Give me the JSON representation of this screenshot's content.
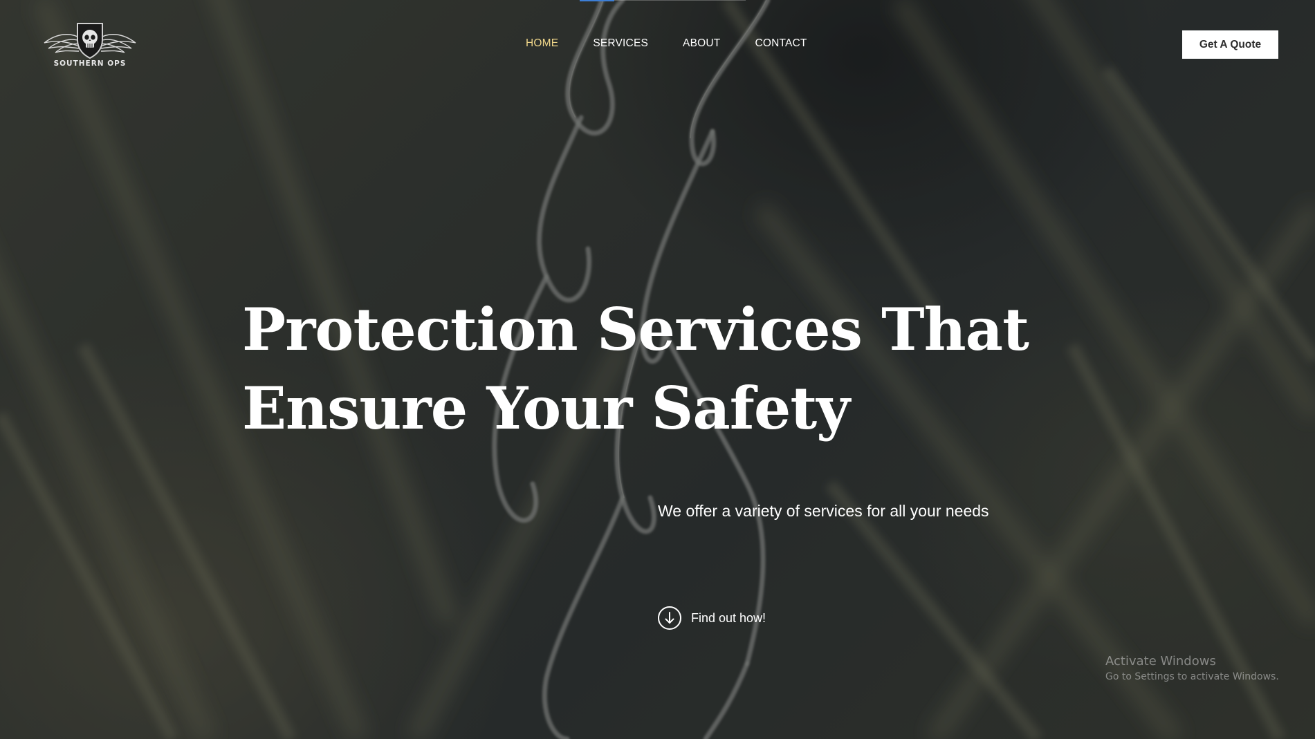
{
  "brand": {
    "logo_text": "SOUTHERN OPS",
    "logo_icon": "winged-skull-shield-logo"
  },
  "nav": {
    "items": [
      {
        "label": "HOME",
        "active": true
      },
      {
        "label": "SERVICES",
        "active": false
      },
      {
        "label": "ABOUT",
        "active": false
      },
      {
        "label": "CONTACT",
        "active": false
      }
    ],
    "active_color": "#f0d78a"
  },
  "header": {
    "quote_button_label": "Get A Quote"
  },
  "hero": {
    "headline_line1": "Protection Services That",
    "headline_line2": "Ensure Your Safety",
    "subtext": "We offer a variety of services for all your needs",
    "cta_label": "Find out how!",
    "cta_icon": "arrow-down-circle-icon",
    "background": "blurred chain-link fence"
  },
  "windows_watermark": {
    "title": "Activate Windows",
    "subtitle": "Go to Settings to activate Windows."
  },
  "colors": {
    "accent_line": "#3d7fd6",
    "button_bg": "#ffffff",
    "text": "#ffffff"
  }
}
